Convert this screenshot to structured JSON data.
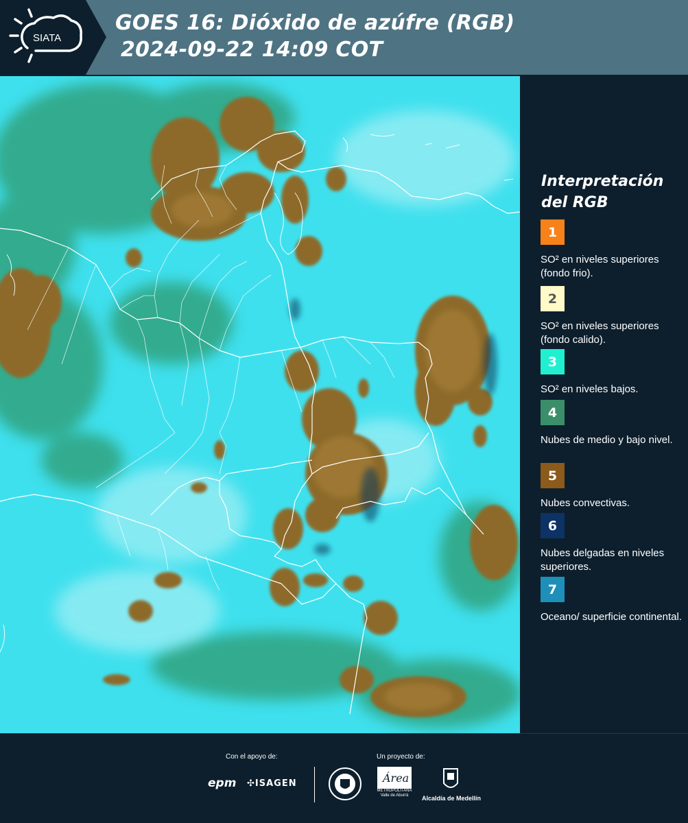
{
  "header": {
    "logo_text": "SIATA",
    "title_line1": "GOES 16: Dióxido de azúfre (RGB)",
    "title_line2": "2024-09-22 14:09 COT"
  },
  "legend": {
    "title": "Interpretación del RGB",
    "items": [
      {
        "number": "1",
        "color": "#f7821a",
        "number_color": "#ffffff",
        "text": "SO² en niveles superiores (fondo frio)."
      },
      {
        "number": "2",
        "color": "#fffac8",
        "number_color": "#555555",
        "text": "SO² en niveles superiores (fondo calido)."
      },
      {
        "number": "3",
        "color": "#20f0d0",
        "number_color": "#ffffff",
        "text": "SO² en niveles bajos."
      },
      {
        "number": "4",
        "color": "#3a8f6a",
        "number_color": "#ffffff",
        "text": "Nubes de medio y bajo nivel."
      },
      {
        "number": "5",
        "color": "#8c5a1a",
        "number_color": "#ffffff",
        "text": "Nubes convectivas."
      },
      {
        "number": "6",
        "color": "#0d3266",
        "number_color": "#ffffff",
        "text": "Nubes delgadas en niveles superiores."
      },
      {
        "number": "7",
        "color": "#1e8fb8",
        "number_color": "#ffffff",
        "text": "Oceano/ superficie continental."
      }
    ]
  },
  "footer": {
    "support_label": "Con el apoyo de:",
    "project_label": "Un proyecto de:",
    "epm": "epm",
    "isagen": "ISAGEN",
    "amva": "METROPOLITANA Valle de Aburrá",
    "amva_script": "Área",
    "alcaldia": "Alcaldía de Medellín"
  },
  "colors": {
    "header_bg": "#4e7383",
    "logo_bg": "#0d1f2d",
    "page_bg": "#0d1f2d",
    "cloud_convective": "#8a6a2a",
    "surface": "#3fe0ee"
  }
}
